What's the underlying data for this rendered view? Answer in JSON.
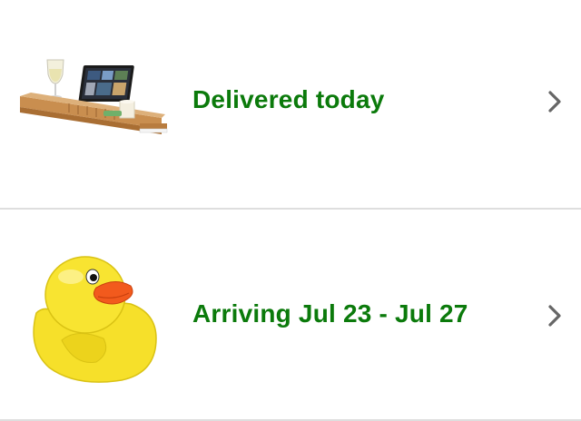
{
  "orders": [
    {
      "status": "Delivered today",
      "image_icon": "bathtub-caddy-tray-image"
    },
    {
      "status": "Arriving Jul 23 - Jul 27",
      "image_icon": "rubber-duck-image"
    }
  ],
  "colors": {
    "status_green": "#0b7a0b",
    "divider": "#dedede",
    "chevron": "#666666"
  },
  "icons": {
    "chevron": "chevron-right-icon"
  }
}
